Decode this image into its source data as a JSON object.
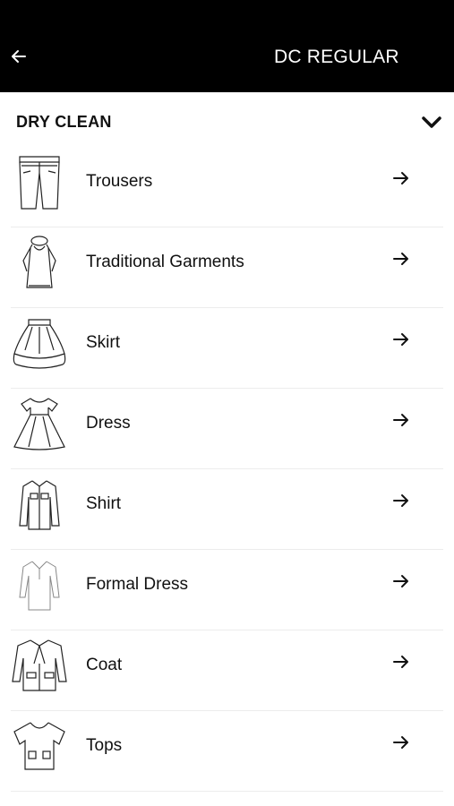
{
  "header": {
    "title": "DC REGULAR",
    "back_icon": "arrow-left-icon",
    "background": "#000000",
    "text_color": "#ffffff"
  },
  "section": {
    "title": "DRY CLEAN",
    "toggle_icon": "chevron-down-icon"
  },
  "items": [
    {
      "label": "Trousers",
      "icon": "trousers-icon"
    },
    {
      "label": "Traditional Garments",
      "icon": "traditional-garment-icon"
    },
    {
      "label": "Skirt",
      "icon": "skirt-icon"
    },
    {
      "label": "Dress",
      "icon": "dress-icon"
    },
    {
      "label": "Shirt",
      "icon": "shirt-icon"
    },
    {
      "label": "Formal Dress",
      "icon": "formal-dress-icon"
    },
    {
      "label": "Coat",
      "icon": "coat-icon"
    },
    {
      "label": "Tops",
      "icon": "tops-icon"
    }
  ]
}
